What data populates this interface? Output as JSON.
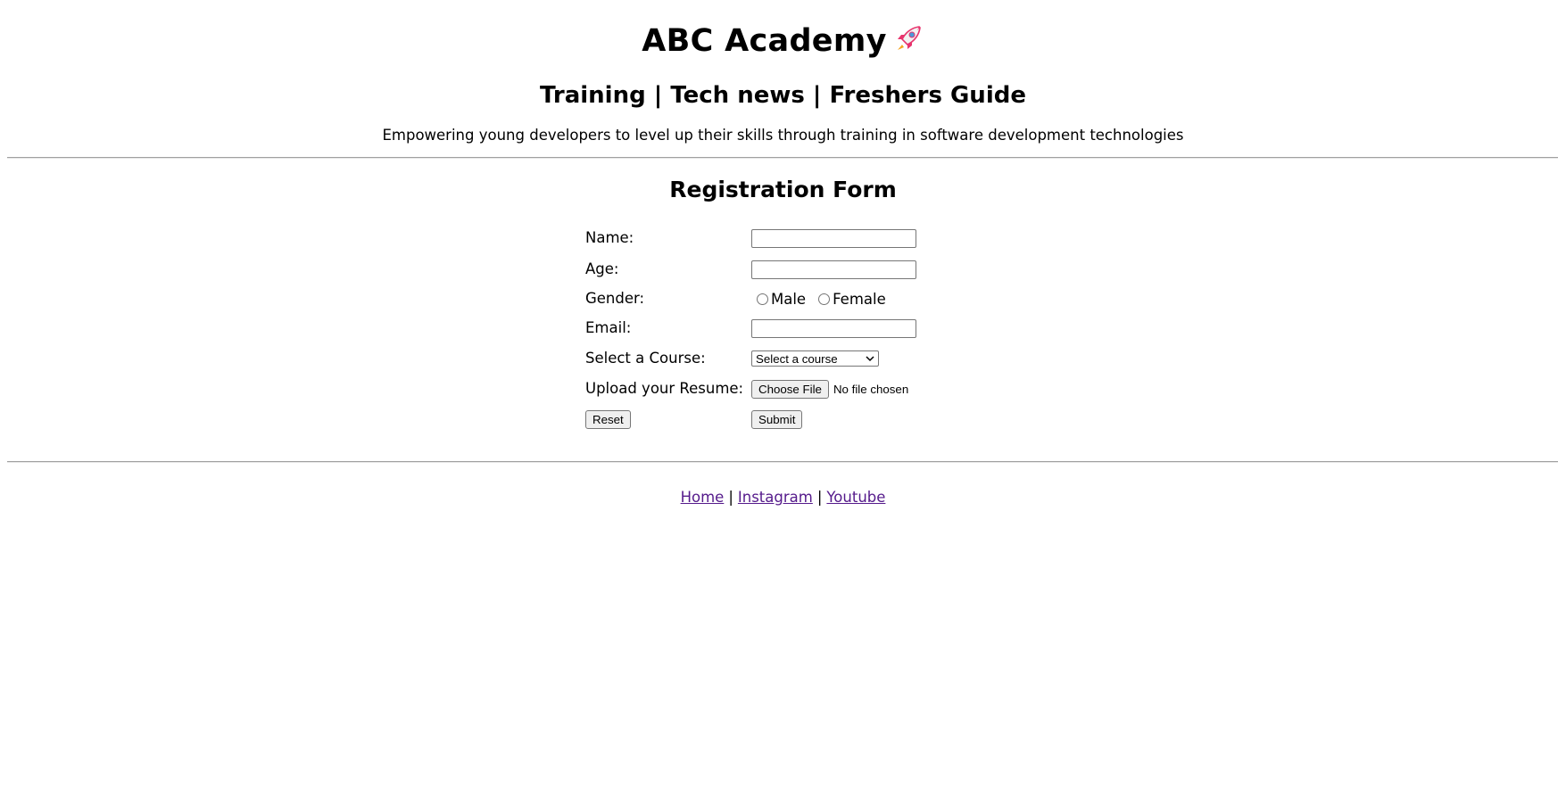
{
  "header": {
    "title": "ABC Academy",
    "nav": "Training | Tech news | Freshers Guide",
    "tagline": "Empowering young developers to level up their skills through training in software development technologies"
  },
  "form": {
    "title": "Registration Form",
    "name_label": "Name:",
    "name_value": "",
    "age_label": "Age:",
    "age_value": "",
    "gender_label": "Gender:",
    "gender_options": [
      "Male",
      "Female"
    ],
    "email_label": "Email:",
    "email_value": "",
    "course_label": "Select a Course:",
    "course_selected": "Select a course",
    "resume_label": "Upload your Resume:",
    "file_button": "Choose File",
    "file_status": "No file chosen",
    "reset_label": "Reset",
    "submit_label": "Submit"
  },
  "footer": {
    "links": [
      "Home",
      "Instagram",
      "Youtube"
    ],
    "separator": "|"
  },
  "icons": {
    "title_icon": "rocket-icon",
    "select_icon": "chevron-down-icon"
  },
  "colors": {
    "link_visited": "#551a8b",
    "rocket_body": "#e8336d"
  }
}
